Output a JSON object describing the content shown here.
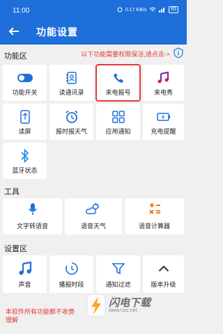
{
  "status": {
    "time": "11:00",
    "speed": "0.17 KB/s",
    "battery": "65"
  },
  "appbar": {
    "title": "功能设置"
  },
  "sections": {
    "functions": "功能区",
    "tools": "工具",
    "settings": "设置区"
  },
  "notice": "以下功能需要权限保活,请点击->",
  "tiles": [
    {
      "label": "功能开关",
      "icon": "toggle-icon"
    },
    {
      "label": "读通讯录",
      "icon": "contacts-icon"
    },
    {
      "label": "来电报号",
      "icon": "phone-icon"
    },
    {
      "label": "来电秀",
      "icon": "music-icon"
    },
    {
      "label": "读屏",
      "icon": "screen-read-icon"
    },
    {
      "label": "报时报天气",
      "icon": "alarm-clock-icon"
    },
    {
      "label": "应用通知",
      "icon": "grid-apps-icon"
    },
    {
      "label": "充电提醒",
      "icon": "battery-charge-icon"
    },
    {
      "label": "蓝牙状态",
      "icon": "bluetooth-icon"
    }
  ],
  "tools": [
    {
      "label": "文字转语音",
      "icon": "microphone-icon"
    },
    {
      "label": "语音天气",
      "icon": "weather-icon"
    },
    {
      "label": "语音计算器",
      "icon": "calculator-icon"
    }
  ],
  "settings": [
    {
      "label": "声音",
      "icon": "music-note-icon"
    },
    {
      "label": "播报时段",
      "icon": "time-range-icon"
    },
    {
      "label": "通知过滤",
      "icon": "filter-icon"
    },
    {
      "label": "版本升级",
      "icon": "chevron-up-icon"
    }
  ],
  "footer": "本软件所有功能都不收费",
  "footer_line2": "理解",
  "watermark": {
    "title": "闪电下载",
    "sub": "www.Uzz.net"
  },
  "colors": {
    "primary": "#1e6fd9",
    "accent": "#e53935"
  }
}
